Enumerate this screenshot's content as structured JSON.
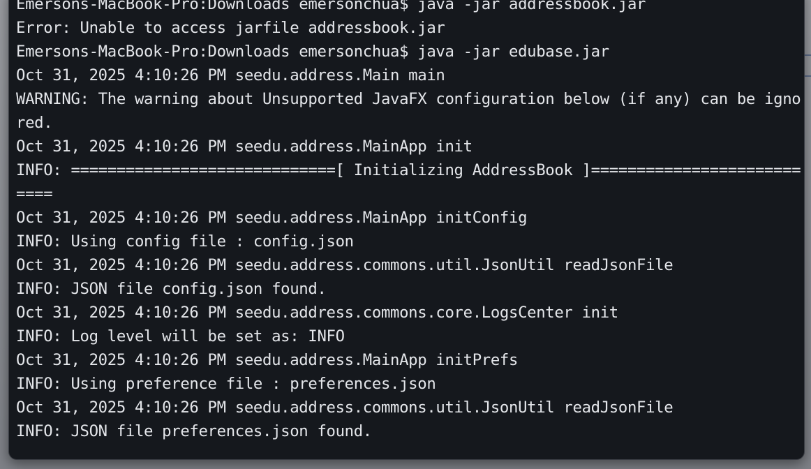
{
  "window": {
    "background_color": "#15181d",
    "text_color": "#e4e6ea"
  },
  "terminal": {
    "lines": [
      "Emersons-MacBook-Pro:Downloads emersonchua$ java -jar addressbook.jar",
      "Error: Unable to access jarfile addressbook.jar",
      "Emersons-MacBook-Pro:Downloads emersonchua$ java -jar edubase.jar",
      "Oct 31, 2025 4:10:26 PM seedu.address.Main main",
      "WARNING: The warning about Unsupported JavaFX configuration below (if any) can be ignored.",
      "Oct 31, 2025 4:10:26 PM seedu.address.MainApp init",
      "INFO: =============================[ Initializing AddressBook ]===========================",
      "Oct 31, 2025 4:10:26 PM seedu.address.MainApp initConfig",
      "INFO: Using config file : config.json",
      "Oct 31, 2025 4:10:26 PM seedu.address.commons.util.JsonUtil readJsonFile",
      "INFO: JSON file config.json found.",
      "Oct 31, 2025 4:10:26 PM seedu.address.commons.core.LogsCenter init",
      "INFO: Log level will be set as: INFO",
      "Oct 31, 2025 4:10:26 PM seedu.address.MainApp initPrefs",
      "INFO: Using preference file : preferences.json",
      "Oct 31, 2025 4:10:26 PM seedu.address.commons.util.JsonUtil readJsonFile",
      "INFO: JSON file preferences.json found."
    ]
  }
}
